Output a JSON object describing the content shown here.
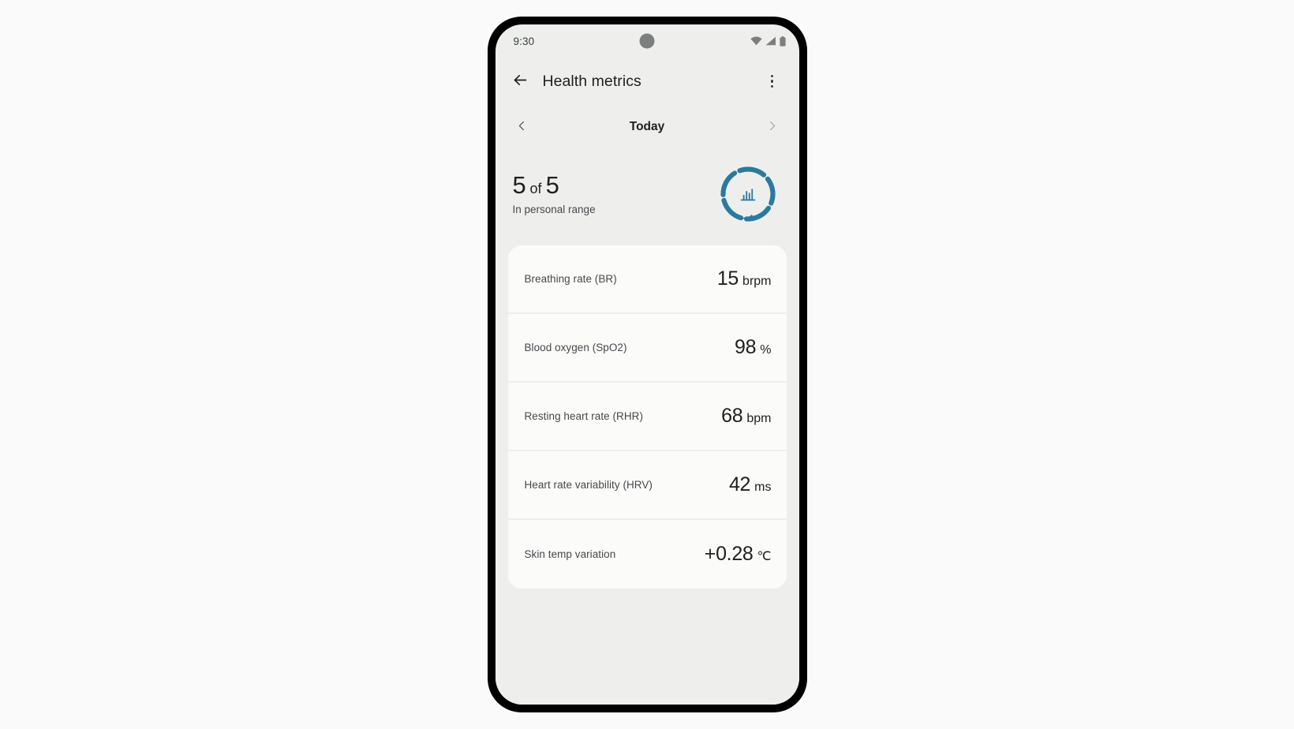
{
  "status_bar": {
    "time": "9:30",
    "icons": [
      "wifi-icon",
      "cellular-signal-icon",
      "battery-icon"
    ]
  },
  "app_bar": {
    "back_icon": "back-arrow-icon",
    "title": "Health metrics",
    "overflow_icon": "more-vertical-icon"
  },
  "date_nav": {
    "prev_icon": "chevron-left-icon",
    "label": "Today",
    "next_icon": "chevron-right-icon"
  },
  "summary": {
    "score": "5",
    "of_label": "of",
    "total": "5",
    "subtitle": "In personal range",
    "ring": {
      "segments_total": 5,
      "segments_filled": 5,
      "accent_color": "#2b7a9e",
      "center_icon": "bar-chart-icon",
      "badge_icon": "check-icon"
    }
  },
  "metrics": [
    {
      "label": "Breathing rate (BR)",
      "value": "15",
      "unit": "brpm"
    },
    {
      "label": "Blood oxygen (SpO2)",
      "value": "98",
      "unit": "%"
    },
    {
      "label": "Resting heart rate (RHR)",
      "value": "68",
      "unit": "bpm"
    },
    {
      "label": "Heart rate variability (HRV)",
      "value": "42",
      "unit": "ms"
    },
    {
      "label": "Skin temp variation",
      "value": "+0.28",
      "unit": "℃"
    }
  ]
}
